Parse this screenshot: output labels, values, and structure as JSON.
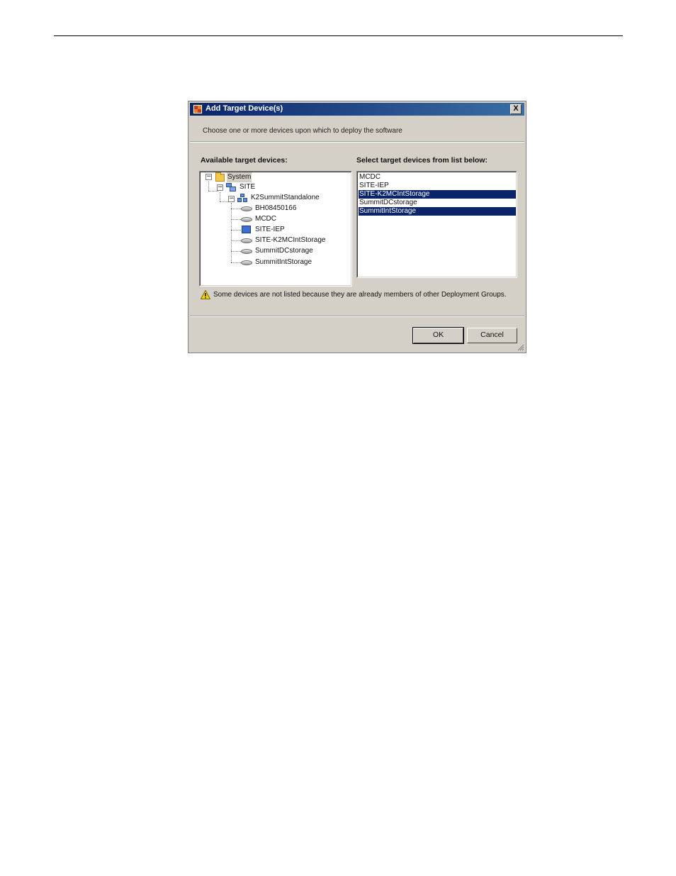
{
  "dialog": {
    "title": "Add Target Device(s)",
    "close_label": "X",
    "instruction": "Choose one or more devices upon which to deploy the software",
    "available_label": "Available target devices:",
    "select_label": "Select target devices from list below:",
    "warning": "Some devices are not listed because they are already members of other Deployment Groups.",
    "ok_label": "OK",
    "cancel_label": "Cancel"
  },
  "tree": {
    "root": "System",
    "site": "SITE",
    "group": "K2SummitStandalone",
    "devices": [
      "BH08450166",
      "MCDC",
      "SITE-IEP",
      "SITE-K2MCIntStorage",
      "SummitDCstorage",
      "SummitIntStorage"
    ],
    "device_icons": [
      "disk-icon",
      "disk-icon",
      "monitor-icon",
      "disk-icon",
      "disk-icon",
      "disk-icon"
    ]
  },
  "target_list": {
    "items": [
      "MCDC",
      "SITE-IEP",
      "SITE-K2MCIntStorage",
      "SummitDCstorage",
      "SummitIntStorage"
    ],
    "selected": [
      false,
      false,
      true,
      false,
      true
    ]
  },
  "colors": {
    "title_start": "#0a246a",
    "title_end": "#3a6ea5",
    "selection": "#0a246a",
    "dialog_bg": "#d4d0c8"
  }
}
